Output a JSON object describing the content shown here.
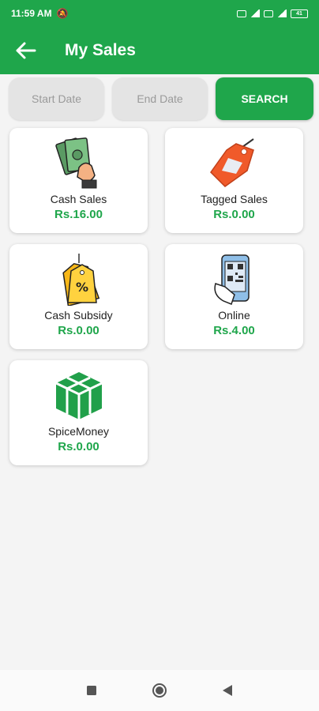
{
  "status_bar": {
    "time": "11:59 AM",
    "battery": "41"
  },
  "app_bar": {
    "title": "My Sales",
    "back_icon": "arrow-left-icon"
  },
  "filters": {
    "start_date_placeholder": "Start Date",
    "end_date_placeholder": "End Date",
    "search_label": "SEARCH"
  },
  "cards": [
    {
      "label": "Cash Sales",
      "amount": "Rs.16.00",
      "icon": "cash-in-hand-icon"
    },
    {
      "label": "Tagged Sales",
      "amount": "Rs.0.00",
      "icon": "price-tag-icon"
    },
    {
      "label": "Cash Subsidy",
      "amount": "Rs.0.00",
      "icon": "discount-tag-icon"
    },
    {
      "label": "Online",
      "amount": "Rs.4.00",
      "icon": "phone-qr-icon"
    },
    {
      "label": "SpiceMoney",
      "amount": "Rs.0.00",
      "icon": "spicemoney-logo-icon"
    }
  ],
  "colors": {
    "primary": "#1fa64b",
    "background": "#f4f4f4",
    "card": "#ffffff"
  }
}
